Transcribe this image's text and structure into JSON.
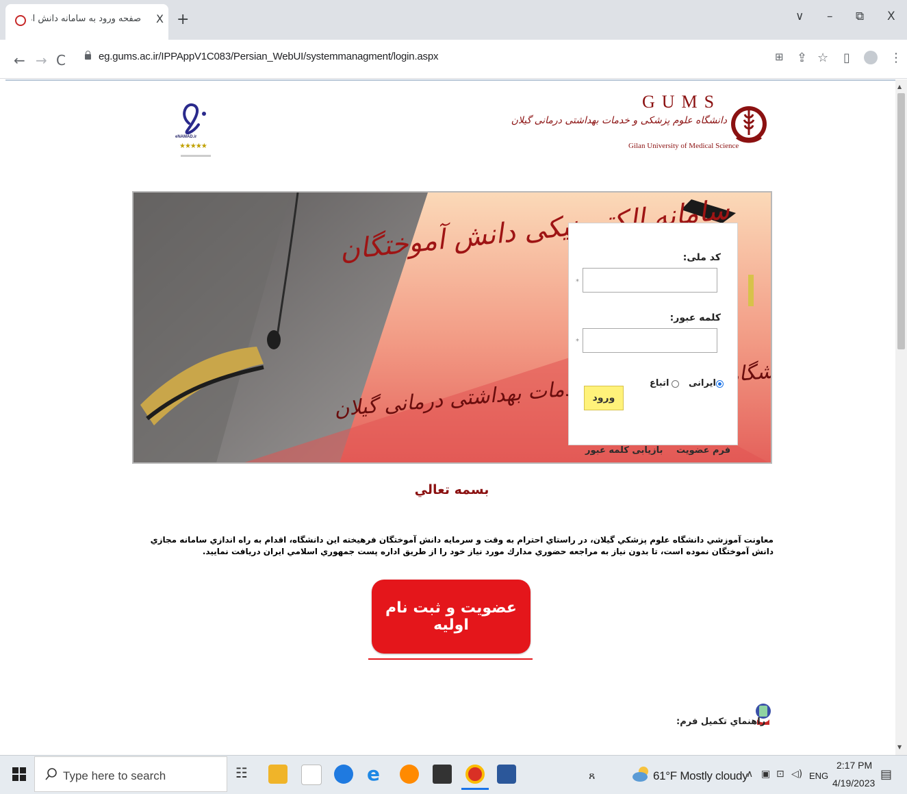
{
  "browser": {
    "tab_title": "صفحه ورود به سامانه دانش آموختگان",
    "new_tab_symbol": "+",
    "close_tab_symbol": "X",
    "url": "eg.gums.ac.ir/IPPAppV1C083/Persian_WebUI/systemmanagment/login.aspx",
    "window_buttons": {
      "dropdown": "∨",
      "minimize": "–",
      "restore": "⧉",
      "close": "X"
    }
  },
  "page": {
    "enamad": {
      "label": "eNAMAD.ir",
      "stars": "★★★★★"
    },
    "gums": {
      "letters": "GUMS",
      "persian_name": "دانشگاه علوم پزشکی و خدمات بهداشتی درمانی گیلان",
      "english_name": "Gilan University of Medical Science"
    },
    "banner": {
      "title": "سامانه الکترونیکی دانش آموختگان",
      "subtitle": "دانشگاه علوم پزشکی و خدمات بهداشتی درمانی گیلان"
    },
    "login": {
      "national_code_label": "کد ملی:",
      "password_label": "کلمه عبور:",
      "required_mark": "*",
      "radio_iranian": "ایرانی",
      "radio_foreign": "اتباع",
      "selected_radio": "ایرانی",
      "submit_label": "ورود",
      "membership_form_link": "فرم عضویت",
      "recover_password_link": "بازیابی کلمه عبور"
    },
    "besmeh": "بسمه تعالي",
    "intro_text": "معاونت آموزشي دانشگاه علوم پزشکي گيلان، در راستاي احترام به وقت و سرمايه دانش آموختگان فرهيخته اين دانشگاه، اقدام به راه اندازي سامانه مجازي دانش آموختگان نموده است، تا بدون نياز به مراجعه حضوري مدارك مورد نياز خود را از طريق اداره پست جمهوري اسلامي ايران دريافت نماييد.",
    "register_button": "عضویت و ثبت نام اولیه",
    "guide_label": "راهنماي تكميل فرم:"
  },
  "taskbar": {
    "search_placeholder": "Type here to search",
    "weather": "61°F  Mostly cloudy",
    "language": "ENG",
    "time": "2:17 PM",
    "date": "4/19/2023"
  },
  "colors": {
    "brand_red": "#8b1111",
    "register_red": "#e4161b",
    "login_button_yellow": "#fff27a"
  }
}
